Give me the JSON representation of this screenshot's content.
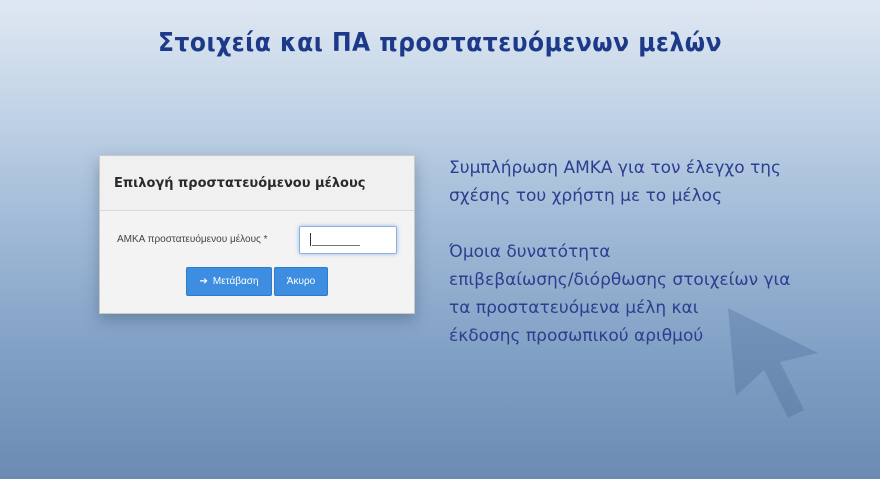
{
  "slide": {
    "title": "Στοιχεία και ΠΑ προστατευόμενων μελών"
  },
  "dialog": {
    "header": "Επιλογή προστατευόμενου μέλους",
    "field_label": "ΑΜΚΑ προστατευόμενου μέλους *",
    "field_value": "",
    "go_button": "Μετάβαση",
    "go_icon": "arrow-right-icon",
    "cancel_button": "Άκυρο"
  },
  "description": {
    "line1_a": "Συμπλήρωση ΑΜΚΑ για τον έλεγχο της",
    "line1_b": "σχέσης του χρήστη με το μέλος",
    "line2_a": "Όμοια δυνατότητα",
    "line2_b": "επιβεβαίωσης/διόρθωσης στοιχείων για",
    "line2_c": "τα προστατευόμενα μέλη και",
    "line2_d": "έκδοσης προσωπικού αριθμού"
  },
  "colors": {
    "title": "#1d3a8a",
    "text": "#2c3e8f",
    "button": "#3d8ee0"
  }
}
